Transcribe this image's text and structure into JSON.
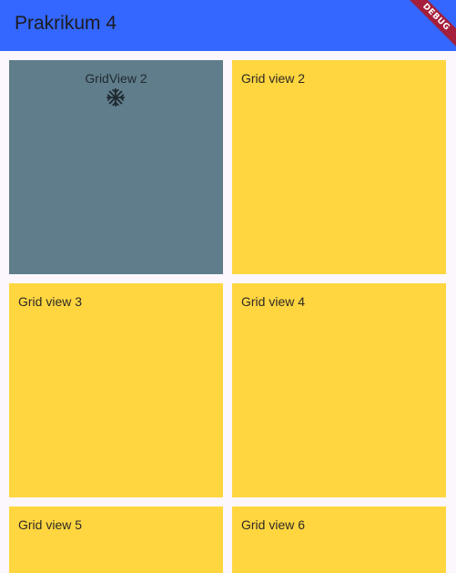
{
  "appbar": {
    "title": "Prakrikum 4",
    "background_color": "#3367ff"
  },
  "debug_banner": {
    "label": "DEBUG"
  },
  "grid": {
    "tiles": [
      {
        "label": "GridView 2",
        "color": "#607d8b",
        "icon": "snowflake-icon"
      },
      {
        "label": "Grid view 2",
        "color": "#ffd640"
      },
      {
        "label": "Grid view 3",
        "color": "#ffd640"
      },
      {
        "label": "Grid view 4",
        "color": "#ffd640"
      },
      {
        "label": "Grid view 5",
        "color": "#ffd640"
      },
      {
        "label": "Grid view 6",
        "color": "#ffd640"
      }
    ]
  }
}
